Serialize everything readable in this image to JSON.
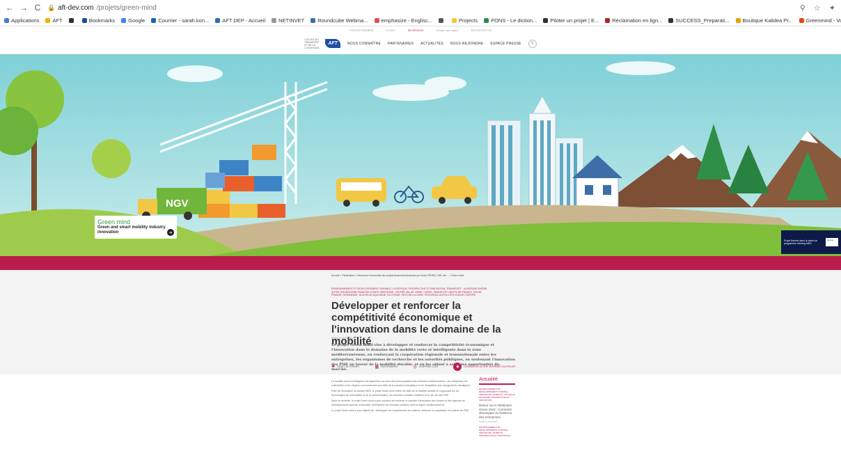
{
  "browser": {
    "back": "←",
    "forward": "→",
    "reload": "C",
    "url_host": "aft-dev.com",
    "url_path": "/projets/green-mind",
    "icons": [
      "zoom-icon",
      "star-icon",
      "extension-icon"
    ]
  },
  "bookmarks": [
    {
      "label": "Applications",
      "color": "#4a7bd6"
    },
    {
      "label": "AFT",
      "color": "#f0b400"
    },
    {
      "label": "",
      "color": "#333"
    },
    {
      "label": "Bookmarks",
      "color": "#1a4fa0"
    },
    {
      "label": "Google",
      "color": "#4285f4"
    },
    {
      "label": "Courrier - sarah.kon...",
      "color": "#1565c0"
    },
    {
      "label": "AFT DEP - Accueil",
      "color": "#2d6db5"
    },
    {
      "label": "NETINVET",
      "color": "#999"
    },
    {
      "label": "Roundcube Webma...",
      "color": "#3a6fb0"
    },
    {
      "label": "emphasize - Englisc...",
      "color": "#d9534f"
    },
    {
      "label": "",
      "color": "#555"
    },
    {
      "label": "Projects",
      "color": "#f5c542"
    },
    {
      "label": "PONS - Le diction...",
      "color": "#2e8b57"
    },
    {
      "label": "Piloter un projet | E...",
      "color": "#333"
    },
    {
      "label": "Réclamation en lign...",
      "color": "#b22222"
    },
    {
      "label": "SUCCESS_Preparati...",
      "color": "#333"
    },
    {
      "label": "Boutique Kalidea Pr...",
      "color": "#e6a100"
    },
    {
      "label": "Greenmind - Voxx +...",
      "color": "#e64a19"
    }
  ],
  "topstrip": {
    "left": "ESPACE MEMBRE",
    "mid1": "E-DOC",
    "mid2": "EN RÉGION",
    "mid3": "Choisir une région",
    "right": "RECRUTER UN"
  },
  "nav": {
    "logo_tagline": "L'ÉCOLE DU TRANSPORT ET DE LA LOGISTIQUE",
    "logo_text": "AFT",
    "items": [
      "NOUS CONNAÎTRE",
      "PARTENAIRES",
      "ACTUALITÉS",
      "NOUS REJOINDRE",
      "ESPACE PRESSE"
    ]
  },
  "hero": {
    "label_title": "Green mind",
    "label_sub": "Green and smart mobility industry innovation",
    "truck_text": "NGV",
    "funded_text": "Projet financé dans le cadre du programme Interreg MED",
    "funded_logo": "Interreg"
  },
  "breadcrumb": "Accueil > Partenaires > Découvrez l'ensemble des projets financés/cofinancés par fonds FEDER, FSE, etc... > Green mind",
  "tags": "ENVIRONNEMENT ET DÉVELOPPEMENT DURABLE, LOGISTIQUE, PROSPECTIVE ET INNOVATION, TRANSPORT · AUVERGNE-RHÔNE-ALPES, BOURGOGNE-FRANCHE-COMTÉ, BRETAGNE, CENTRE-VAL DE LOIRE, CORSE, GRAND EST, HAUTS-DE-FRANCE, ÎLE-DE-FRANCE, NORMANDIE, NOUVELLE-AQUITAINE, OCCITANIE, PAYS DE LA LOIRE, PROVENCE-ALPES-CÔTE D'AZUR, EUROPE",
  "title": "Développer et renforcer la compétitivité économique et l'innovation dans le domaine de la mobilité",
  "date": "Publié le 21/05/2021",
  "lead": "Le projet Green mind vise à développer et renforcer la compétitivité économique et l'innovation dans le domaine de la mobilité verte et intelligente dans la zone méditerranéenne, en renforçant la coopération régionale et transnationale entre les entreprises, les organismes de recherche et les autorités publiques, en soutenant l'innovation des PME en faveur de la mobilité durable, et en les aidant à saisir les opportunités du marché.",
  "actions": [
    {
      "icon": "⚑",
      "label": "OBJET DU PROJET"
    },
    {
      "icon": "▦",
      "label": "PARTENAIRES"
    },
    {
      "icon": "◎",
      "label": "CHIFFRES CLÉS"
    },
    {
      "icon": "◉",
      "label": "CONSULTER LE SITE INTERNET DU PROJET"
    }
  ],
  "body": [
    "La mobilité verte et intelligente est aujourd'hui au cœur des préoccupations des territoires méditerranéens : les entreprises, les collectivités et les citoyens sont confrontés aux défis de la transition énergétique et de l'adaptation aux changements climatiques.",
    "Pilier de l'innovation du secteur MED, le projet Green mind relève les défis de la mobilité durable en s'appuyant sur les technologies de l'information et de la communication, les nouveaux modèles d'affaires et le rôle clé des PME.",
    "Dans ce contexte, le projet Green mind a pour vocation de renforcer la capacité d'innovation des clusters et des agences de développement régional, et favoriser l'émergence de nouvelles solutions dans la région méditerranéenne.",
    "Le projet Green mind a pour objectif de : développer les compétences des acteurs, renforcer la coopération et soutenir les PME."
  ],
  "sidebar": {
    "heading": "Actualité",
    "category": "ENVIRONNEMENT ET DÉVELOPPEMENT DURABLE, INNOVATION, MOBILITÉ, NOUVELLE ÉCONOMIE, PROSPECTIVE ET INNOVATION",
    "news_title": "Retour sur le Webinaire Green mind : Comment développer la résilience des entreprises",
    "news_date": "Publié le 20/04/2021",
    "category2": "ENVIRONNEMENT ET DÉVELOPPEMENT DURABLE, INNOVATION, MOBILITÉ, PROSPECTIVE ET INNOVATION"
  }
}
